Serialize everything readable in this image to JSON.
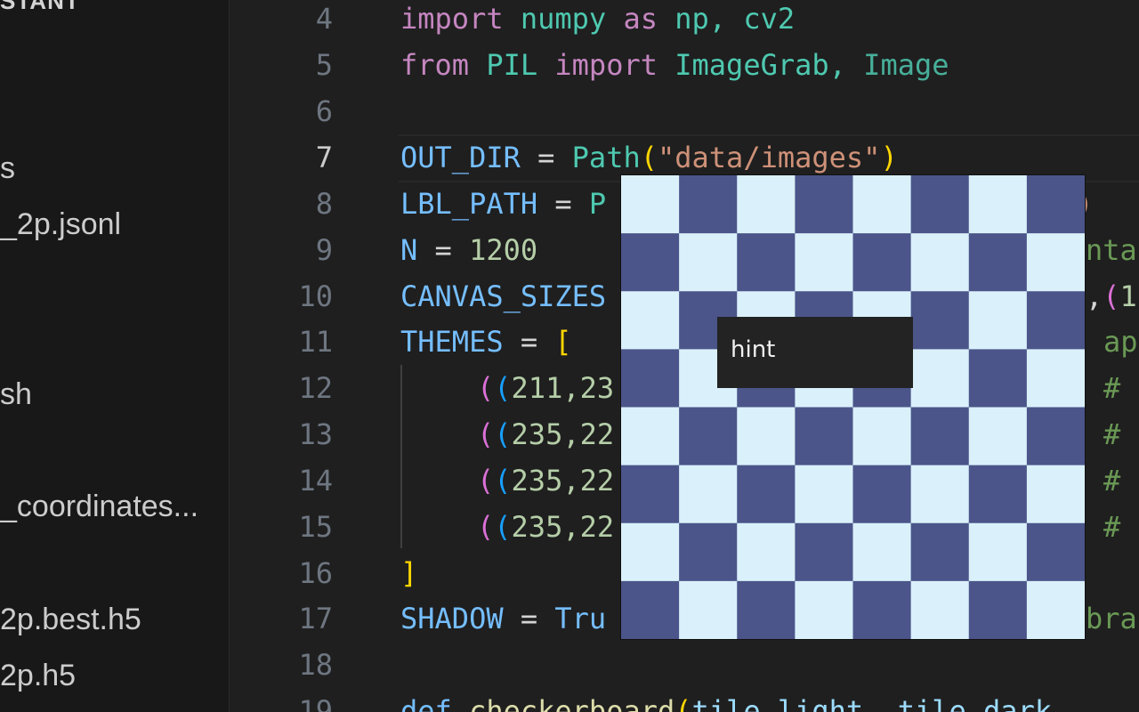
{
  "sidebar": {
    "header": "STANT",
    "items": [
      {
        "label": "s"
      },
      {
        "label": "_2p.jsonl"
      },
      {
        "label": "sh"
      },
      {
        "label": "_coordinates..."
      },
      {
        "label": "2p.best.h5"
      },
      {
        "label": "2p.h5"
      }
    ]
  },
  "editor": {
    "line_numbers": [
      "4",
      "5",
      "6",
      "7",
      "8",
      "9",
      "10",
      "11",
      "12",
      "13",
      "14",
      "15",
      "16",
      "17",
      "18",
      "19"
    ],
    "active_line": "7",
    "lines": {
      "l4": {
        "a": "import",
        "b": " numpy ",
        "c": "as",
        "d": " np, ",
        "e": "cv2"
      },
      "l5": {
        "a": "from",
        "b": " PIL ",
        "c": "import",
        "d": " ImageGrab, ",
        "e": "Image"
      },
      "l7": {
        "a": "OUT_DIR",
        "b": " = ",
        "c": "Path",
        "d": "(",
        "e": "\"data/images\"",
        "f": ")"
      },
      "l8": {
        "a": "LBL_PATH",
        "b": " = ",
        "c": "P",
        "d": "\")"
      },
      "l9": {
        "a": "N",
        "b": " = ",
        "c": "1200",
        "d": "nta"
      },
      "l10": {
        "a": "CANVAS_SIZES",
        "b": ",",
        "c": "(",
        "d": "1"
      },
      "l11": {
        "a": "THEMES",
        "b": " = ",
        "c": "[",
        "d": "ap"
      },
      "l12": {
        "a": "(",
        "b": "(",
        "c": "211,23",
        "d": "#"
      },
      "l13": {
        "a": "(",
        "b": "(",
        "c": "235,22",
        "d": "#"
      },
      "l14": {
        "a": "(",
        "b": "(",
        "c": "235,22",
        "d": "#"
      },
      "l15": {
        "a": "(",
        "b": "(",
        "c": "235,22",
        "d": "#"
      },
      "l16": {
        "a": "]"
      },
      "l17": {
        "a": "SHADOW",
        "b": " = ",
        "c": "Tru",
        "d": "bra"
      },
      "l19": {
        "a": "def",
        "b": " ",
        "c": "checkerboard",
        "d": "(",
        "e": "tile_light, tile_dark"
      }
    }
  },
  "overlay": {
    "hint_label": "hint",
    "rows": 8,
    "cols": 8,
    "light_color": "#daf1fb",
    "dark_color": "#4b558a"
  }
}
